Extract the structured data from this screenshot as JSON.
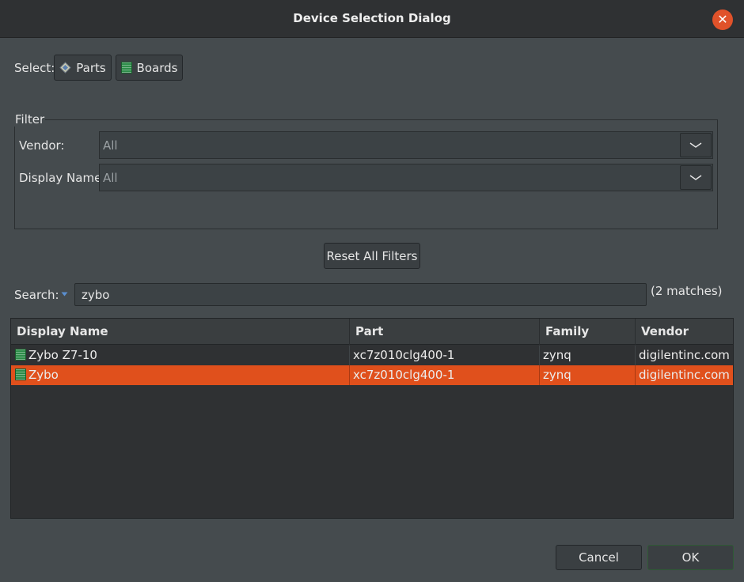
{
  "window": {
    "title": "Device Selection Dialog",
    "close_glyph": "✕"
  },
  "select": {
    "label": "Select:",
    "parts_label": "Parts",
    "boards_label": "Boards"
  },
  "filter": {
    "legend": "Filter",
    "vendor_label": "Vendor:",
    "vendor_value": "All",
    "display_name_label": "Display Name:",
    "display_name_value": "All"
  },
  "reset_label": "Reset All Filters",
  "search": {
    "label": "Search:",
    "value": "zybo",
    "matches": "(2 matches)"
  },
  "table": {
    "columns": [
      "Display Name",
      "Part",
      "Family",
      "Vendor"
    ],
    "rows": [
      {
        "name": "Zybo Z7-10",
        "part": "xc7z010clg400-1",
        "family": "zynq",
        "vendor": "digilentinc.com",
        "selected": false
      },
      {
        "name": "Zybo",
        "part": "xc7z010clg400-1",
        "family": "zynq",
        "vendor": "digilentinc.com",
        "selected": true
      }
    ]
  },
  "footer": {
    "cancel_label": "Cancel",
    "ok_label": "OK"
  },
  "colors": {
    "accent": "#e0501c",
    "background": "#454b4e",
    "titlebar": "#2f3133"
  }
}
